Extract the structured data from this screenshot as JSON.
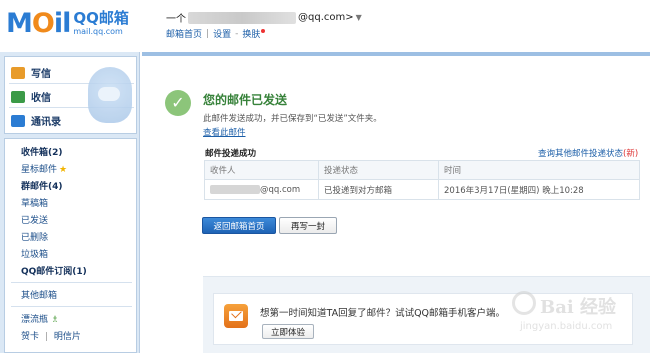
{
  "header": {
    "logo_mail": "M",
    "logo_mail_o": "O",
    "logo_mail_il": "il",
    "logo_qq": "QQ邮箱",
    "logo_url": "mail.qq.com",
    "user_prefix": "一个",
    "user_suffix": "@qq.com>",
    "caret": "▼",
    "links": [
      "邮箱首页",
      "设置",
      "换肤"
    ],
    "sep": "|",
    "dash": "-"
  },
  "sidebar": {
    "actions": [
      {
        "label": "写信",
        "icon": "pencil-icon",
        "color": "#e89b2a"
      },
      {
        "label": "收信",
        "icon": "inbox-download-icon",
        "color": "#3b9a47"
      },
      {
        "label": "通讯录",
        "icon": "contacts-icon",
        "color": "#2b7cd3"
      }
    ],
    "folders": [
      {
        "label": "收件箱(2)",
        "bold": true
      },
      {
        "label": "星标邮件",
        "bold": false,
        "star": "★"
      },
      {
        "label": "群邮件(4)",
        "bold": true
      },
      {
        "label": "草稿箱",
        "bold": false
      },
      {
        "label": "已发送",
        "bold": false
      },
      {
        "label": "已删除",
        "bold": false
      },
      {
        "label": "垃圾箱",
        "bold": false
      },
      {
        "label": "QQ邮件订阅(1)",
        "bold": true
      }
    ],
    "other": "其他邮箱",
    "drift": "漂流瓶",
    "bottle_icon": "♗",
    "card": "贺卡",
    "postcard": "明信片"
  },
  "main": {
    "title": "您的邮件已发送",
    "desc": "此邮件发送成功，并已保存到“已发送”文件夹。",
    "view_link": "查看此邮件",
    "status_title": "邮件投递成功",
    "query_link": "查询其他邮件投递状态",
    "query_new": "(新)",
    "table": {
      "headers": [
        "收件人",
        "投递状态",
        "时间"
      ],
      "rows": [
        {
          "recipient_suffix": "@qq.com",
          "status": "已投递到对方邮箱",
          "time": "2016年3月17日(星期四) 晚上10:28"
        }
      ]
    },
    "btn_home": "返回邮箱首页",
    "btn_again": "再写一封",
    "promo_text": "想第一时间知道TA回复了邮件？试试QQ邮箱手机客户端。",
    "promo_btn": "立即体验"
  },
  "watermark": {
    "text": "Bai 经验",
    "url": "jingyan.baidu.com"
  },
  "colors": {
    "accent": "#2b7cd3",
    "success": "#37823a",
    "link": "#1d5fa8"
  }
}
